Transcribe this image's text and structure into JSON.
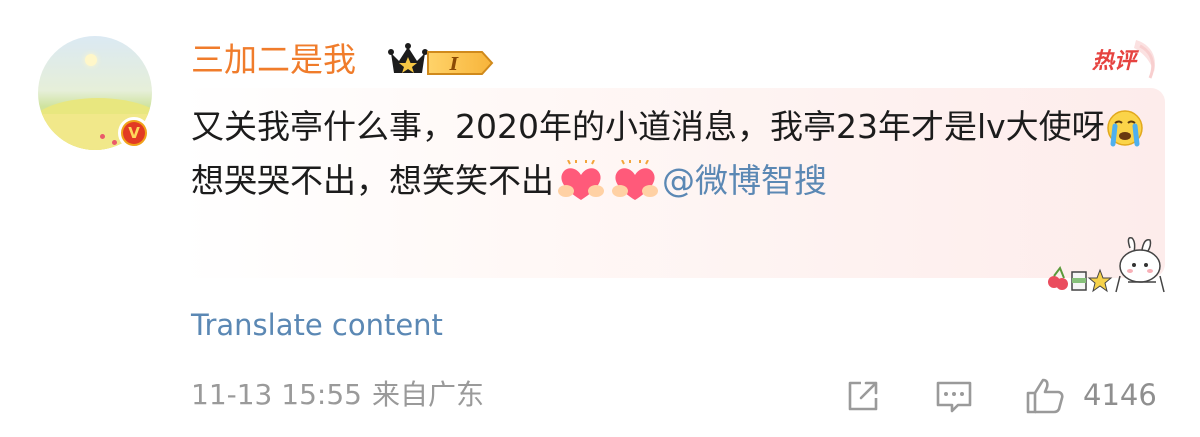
{
  "comment": {
    "username": "三加二是我",
    "level_badge": "I",
    "hot_tag": "热评",
    "body_part1": "又关我亭什么事，2020年的小道消息，我亭23年才是lv大使呀",
    "body_part2": "想哭哭不出，想笑笑不出",
    "mention": "@微博智搜",
    "translate_label": "Translate content",
    "timestamp": "11-13 15:55",
    "location": "来自广东",
    "like_count": "4146",
    "icons": [
      "verified-v-icon",
      "crown-icon",
      "crying-emoji-icon",
      "heart-hands-icon",
      "share-icon",
      "comment-icon",
      "like-icon"
    ]
  },
  "colors": {
    "username": "#f07c2b",
    "link": "#5b88b4",
    "hot_tag": "#e64340",
    "meta_text": "#9a9a9a"
  }
}
